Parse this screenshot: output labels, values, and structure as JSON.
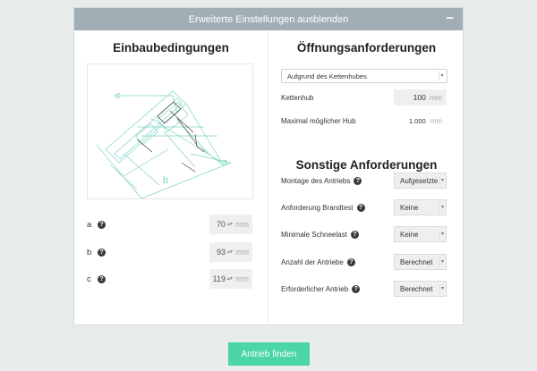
{
  "header": {
    "title": "Erweiterte Einstellungen ausblenden",
    "collapse_symbol": "−"
  },
  "left": {
    "title": "Einbaubedingungen",
    "diagram_labels": {
      "a": "a",
      "b": "b",
      "c": "c"
    },
    "dimensions": [
      {
        "label": "a",
        "value": "70",
        "unit": "mm"
      },
      {
        "label": "b",
        "value": "93",
        "unit": "mm"
      },
      {
        "label": "c",
        "value": "119",
        "unit": "mm"
      }
    ]
  },
  "right": {
    "opening_title": "Öffnungsanforderungen",
    "opening_select": "Aufgrund des Kettenhubes",
    "kettenhub": {
      "label": "Kettenhub",
      "value": "100",
      "unit": "mm"
    },
    "maxhub": {
      "label": "Maximal möglicher Hub",
      "value": "1.000",
      "unit": "mm"
    },
    "other_title": "Sonstige Anforderungen",
    "fields": [
      {
        "label": "Montage des Antriebs",
        "value": "Aufgesetzte"
      },
      {
        "label": "Anforderung Brandtest",
        "value": "Keine"
      },
      {
        "label": "Minimale Schneelast",
        "value": "Keine"
      },
      {
        "label": "Anzahl der Antriebe",
        "value": "Berechnet"
      },
      {
        "label": "Erforderlicher Antrieb",
        "value": "Berechnet"
      }
    ]
  },
  "help_symbol": "?",
  "spinner_symbol": "▴▾",
  "dropdown_symbol": "▾",
  "submit_label": "Antrieb finden",
  "colors": {
    "accent": "#4cd6a5",
    "header_bg": "#a2aeb5",
    "diagram_line": "#7fd3c4"
  }
}
